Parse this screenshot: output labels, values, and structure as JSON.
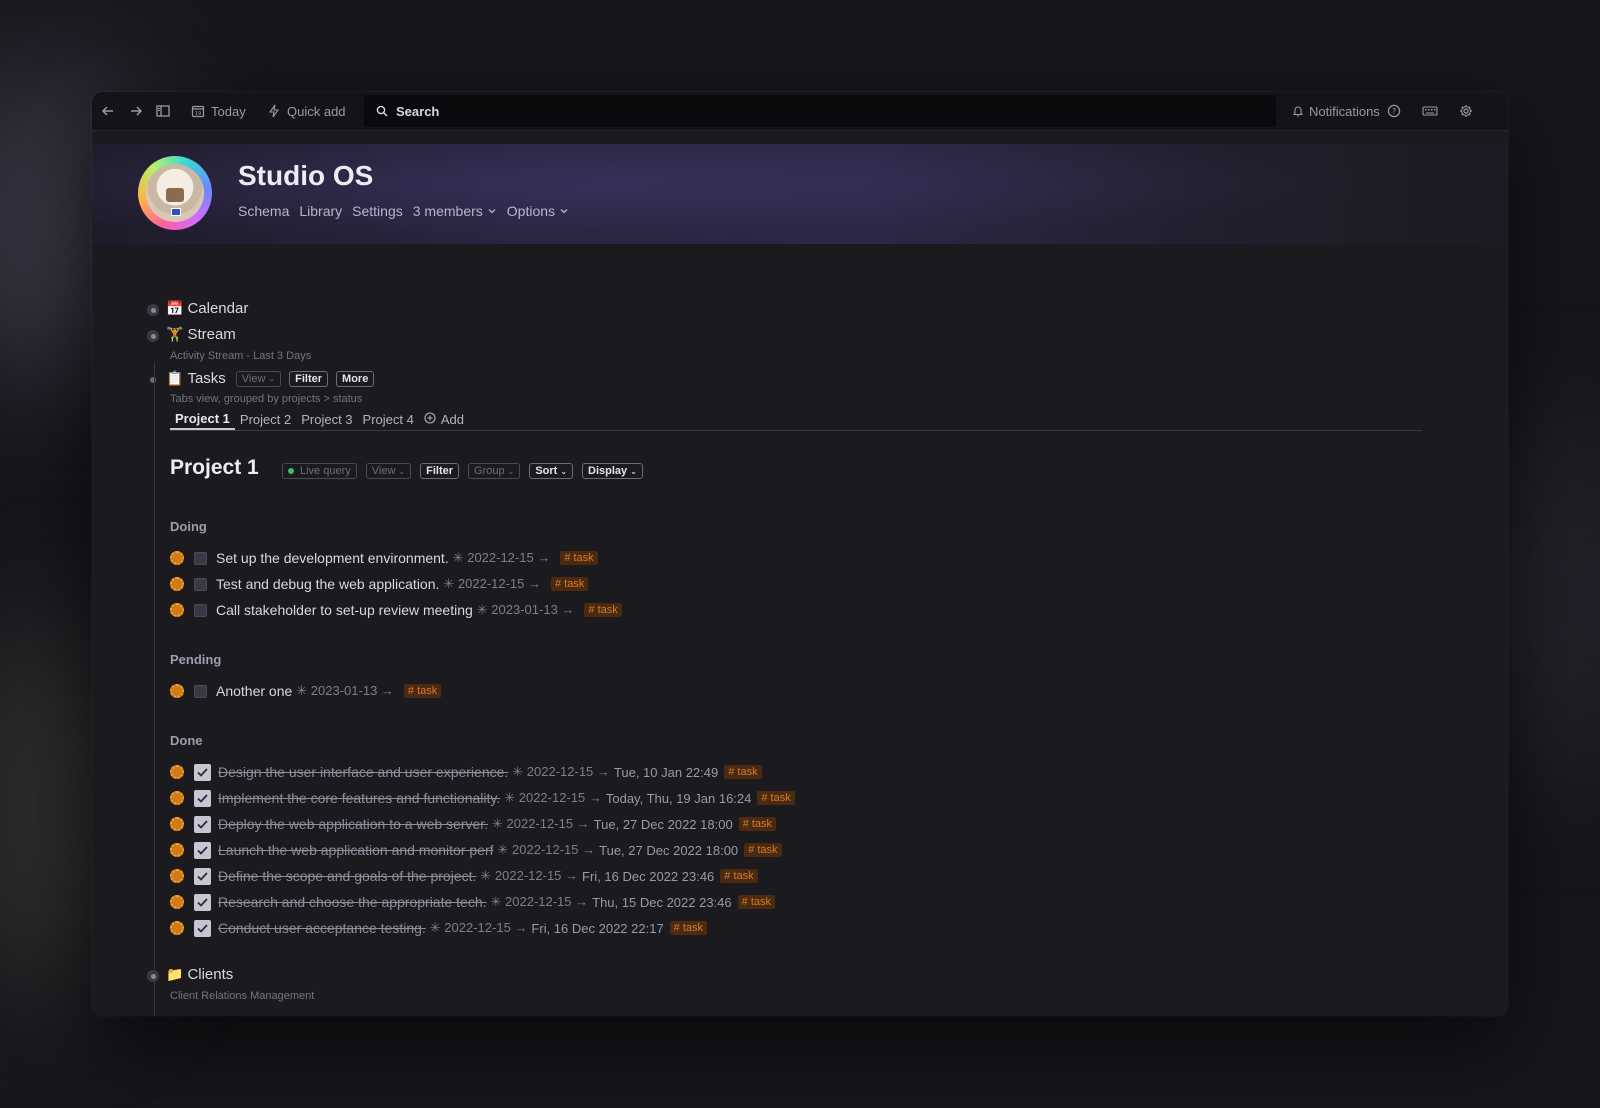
{
  "toolbar": {
    "today": "Today",
    "quick_add": "Quick add",
    "search": "Search",
    "notifications": "Notifications"
  },
  "header": {
    "title": "Studio OS",
    "links": [
      "Schema",
      "Library",
      "Settings"
    ],
    "members": "3 members",
    "options": "Options"
  },
  "outline": {
    "calendar": {
      "emoji": "📅",
      "label": "Calendar"
    },
    "stream": {
      "emoji": "🏋",
      "label": "Stream",
      "subtitle": "Activity Stream - Last 3 Days"
    },
    "tasks": {
      "emoji": "📋",
      "label": "Tasks",
      "view": "View",
      "filter": "Filter",
      "more": "More",
      "subtitle": "Tabs view,  grouped by projects > status"
    },
    "clients": {
      "emoji": "📁",
      "label": "Clients",
      "subtitle": "Client Relations Management"
    }
  },
  "tabs": [
    "Project 1",
    "Project 2",
    "Project 3",
    "Project 4"
  ],
  "add_tab": "Add",
  "project": {
    "title": "Project 1",
    "live_query": "Live query",
    "view": "View",
    "filter": "Filter",
    "group": "Group",
    "sort": "Sort",
    "display": "Display"
  },
  "groups": {
    "doing": {
      "title": "Doing",
      "tasks": [
        {
          "name": "Set up the development environment.",
          "date": "✳ 2022-12-15 →",
          "tag": "# task"
        },
        {
          "name": "Test and debug the web application.",
          "date": "✳ 2022-12-15 →",
          "tag": "# task"
        },
        {
          "name": "Call stakeholder to set-up review meeting",
          "date": "✳ 2023-01-13 →",
          "tag": "# task"
        }
      ]
    },
    "pending": {
      "title": "Pending",
      "tasks": [
        {
          "name": "Another one",
          "date": "✳ 2023-01-13 →",
          "tag": "# task"
        }
      ]
    },
    "done": {
      "title": "Done",
      "tasks": [
        {
          "name": "Design the user interface and user experience.",
          "date": "✳ 2022-12-15 →",
          "time": "Tue, 10 Jan 22:49",
          "tag": "# task"
        },
        {
          "name": "Implement the core features and functionality.",
          "date": "✳ 2022-12-15 →",
          "time": "Today, Thu, 19 Jan 16:24",
          "tag": "# task"
        },
        {
          "name": "Deploy the web application to a web server.",
          "date": "✳ 2022-12-15 →",
          "time": "Tue, 27 Dec 2022 18:00",
          "tag": "# task"
        },
        {
          "name": "Launch the web application and monitor perf",
          "date": "✳ 2022-12-15 →",
          "time": "Tue, 27 Dec 2022 18:00",
          "tag": "# task"
        },
        {
          "name": "Define the scope and goals of the project.",
          "date": "✳ 2022-12-15 →",
          "time": "Fri, 16 Dec 2022 23:46",
          "tag": "# task"
        },
        {
          "name": "Research and choose the appropriate tech.",
          "date": "✳ 2022-12-15 →",
          "time": "Thu, 15 Dec 2022 23:46",
          "tag": "# task"
        },
        {
          "name": "Conduct user acceptance testing.",
          "date": "✳ 2022-12-15 →",
          "time": "Fri, 16 Dec 2022 22:17",
          "tag": "# task"
        }
      ]
    }
  },
  "colors": {
    "accent_tag": "#d8782a",
    "task_sun": "#d17a16",
    "live_dot": "#3fbf6a"
  }
}
